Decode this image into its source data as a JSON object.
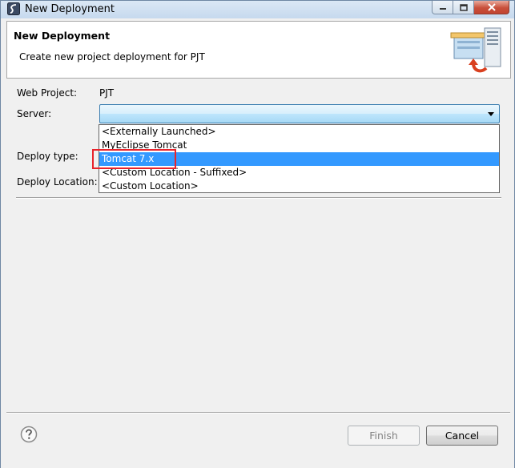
{
  "window": {
    "title": "New Deployment",
    "icons": {
      "app": "myeclipse-logo-icon",
      "minimize": "minimize-icon",
      "maximize": "maximize-icon",
      "close": "close-icon"
    }
  },
  "header": {
    "title": "New Deployment",
    "description": "Create new project deployment for PJT",
    "image": "server-deploy-icon"
  },
  "form": {
    "web_project_label": "Web Project:",
    "web_project_value": "PJT",
    "server_label": "Server:",
    "server_value": "",
    "deploy_type_label": "Deploy type:",
    "deploy_location_label": "Deploy Location:"
  },
  "dropdown": {
    "options": [
      "<Externally Launched>",
      "MyEclipse Tomcat",
      "Tomcat  7.x",
      "<Custom Location - Suffixed>",
      "<Custom Location>"
    ],
    "selected_index": 2
  },
  "annotation": {
    "color": "#e8232b"
  },
  "buttons": {
    "help_icon": "help-icon",
    "finish": "Finish",
    "cancel": "Cancel"
  },
  "colors": {
    "selection": "#3399ff",
    "combo_border": "#3c7fb1"
  }
}
